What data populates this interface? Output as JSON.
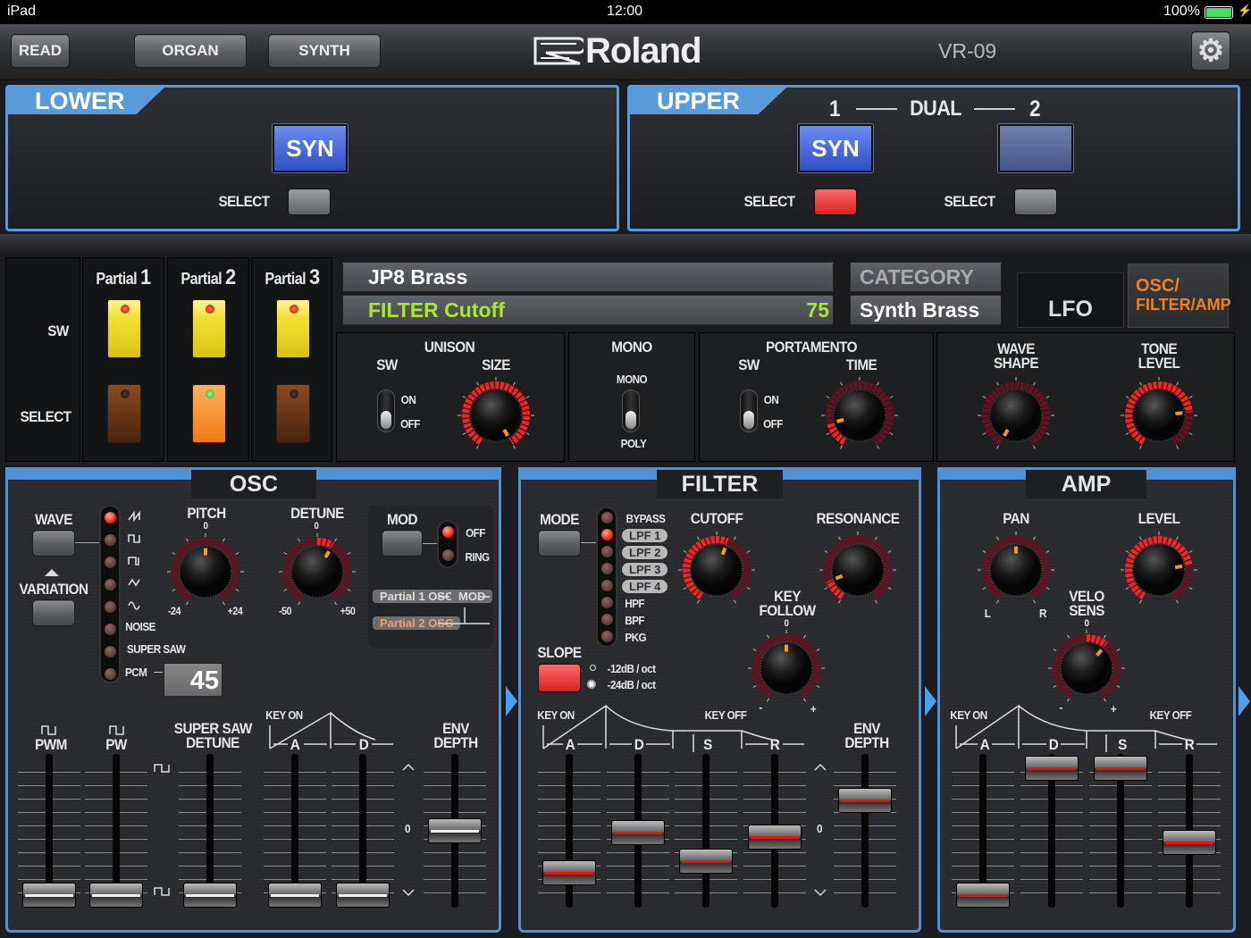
{
  "status": {
    "device": "iPad",
    "time": "12:00",
    "battery": "100%"
  },
  "topbar": {
    "read": "READ",
    "organ": "ORGAN",
    "synth": "SYNTH",
    "logo": "Roland",
    "model": "VR-09"
  },
  "lower": {
    "title": "LOWER",
    "tone": "SYN",
    "select": "SELECT"
  },
  "upper": {
    "title": "UPPER",
    "part1": "1",
    "dual": "DUAL",
    "part2": "2",
    "tone1": "SYN",
    "select1": "SELECT",
    "select2": "SELECT"
  },
  "partials": {
    "sw": "SW",
    "select": "SELECT",
    "items": [
      {
        "label": "Partial",
        "num": "1",
        "selected": false
      },
      {
        "label": "Partial",
        "num": "2",
        "selected": true
      },
      {
        "label": "Partial",
        "num": "3",
        "selected": false
      }
    ]
  },
  "display": {
    "name": "JP8 Brass",
    "param": "FILTER Cutoff",
    "value": "75",
    "category_label": "CATEGORY",
    "category": "Synth Brass"
  },
  "tabs": {
    "lfo": "LFO",
    "osc_line1": "OSC/",
    "osc_line2": "FILTER/AMP"
  },
  "common": {
    "unison": {
      "title": "UNISON",
      "sw": "SW",
      "size": "SIZE",
      "on": "ON",
      "off": "OFF",
      "size_value": 1.0
    },
    "mono": {
      "title": "MONO",
      "mono": "MONO",
      "poly": "POLY"
    },
    "portamento": {
      "title": "PORTAMENTO",
      "sw": "SW",
      "time": "TIME",
      "on": "ON",
      "off": "OFF",
      "time_value": 0.15
    },
    "wave_shape": {
      "line1": "WAVE",
      "line2": "SHAPE",
      "value": 0.0
    },
    "tone_level": {
      "line1": "TONE",
      "line2": "LEVEL",
      "value": 0.78
    }
  },
  "osc": {
    "title": "OSC",
    "wave": "WAVE",
    "variation": "VARIATION",
    "waves": [
      "saw-wave",
      "square-wave",
      "pulse-wave",
      "triangle-wave",
      "sine-wave"
    ],
    "wave_text": {
      "noise": "NOISE",
      "super_saw": "SUPER SAW",
      "pcm": "PCM"
    },
    "selected_wave": 0,
    "pcm_value": "45",
    "pitch": {
      "label": "PITCH",
      "zero": "0",
      "min": "-24",
      "max": "+24",
      "value": 0.5
    },
    "detune": {
      "label": "DETUNE",
      "zero": "0",
      "min": "-50",
      "max": "+50",
      "value": 0.6
    },
    "mod": {
      "label": "MOD",
      "off": "OFF",
      "ring": "RING",
      "partial1": "Partial 1 OSC",
      "mod": "MOD",
      "partial2": "Partial 2 OSC"
    },
    "sliders": {
      "pwm": "PWM",
      "pw": "PW",
      "ssd1": "SUPER SAW",
      "ssd2": "DETUNE",
      "a": "A",
      "d": "D",
      "env1": "ENV",
      "env2": "DEPTH",
      "key_on": "KEY ON",
      "zero": "0",
      "values": {
        "pwm": 0.0,
        "pw": 0.0,
        "ssd": 0.0,
        "a": 0.0,
        "d": 0.0,
        "env": 0.5
      }
    }
  },
  "filter": {
    "title": "FILTER",
    "mode": "MODE",
    "modes": [
      "BYPASS",
      "LPF 1",
      "LPF 2",
      "LPF 3",
      "LPF 4",
      "HPF",
      "BPF",
      "PKG"
    ],
    "selected_mode": 1,
    "slope": "SLOPE",
    "slope_12": "-12dB / oct",
    "slope_24": "-24dB / oct",
    "cutoff": {
      "label": "CUTOFF",
      "value": 0.57
    },
    "resonance": {
      "label": "RESONANCE",
      "value": 0.13
    },
    "key_follow": {
      "line1": "KEY",
      "line2": "FOLLOW",
      "zero": "0",
      "minus": "-",
      "plus": "+",
      "value": 0.5
    },
    "env": {
      "key_on": "KEY ON",
      "key_off": "KEY OFF",
      "a": "A",
      "d": "D",
      "s": "S",
      "r": "R",
      "env1": "ENV",
      "env2": "DEPTH",
      "zero": "0",
      "values": {
        "a": 0.17,
        "d": 0.48,
        "s": 0.26,
        "r": 0.45,
        "env": 0.73
      }
    }
  },
  "amp": {
    "title": "AMP",
    "pan": {
      "label": "PAN",
      "l": "L",
      "r": "R",
      "value": 0.5
    },
    "level": {
      "label": "LEVEL",
      "value": 0.77
    },
    "velo_sens": {
      "line1": "VELO",
      "line2": "SENS",
      "zero": "0",
      "minus": "-",
      "plus": "+",
      "value": 0.63
    },
    "env": {
      "key_on": "KEY ON",
      "key_off": "KEY OFF",
      "a": "A",
      "d": "D",
      "s": "S",
      "r": "R",
      "values": {
        "a": 0.0,
        "d": 0.98,
        "s": 0.98,
        "r": 0.41
      }
    }
  },
  "colors": {
    "accent": "#5a9ad8",
    "led_on": "#f02810",
    "pointer": "#f59a10",
    "ring": "#ff2020"
  }
}
